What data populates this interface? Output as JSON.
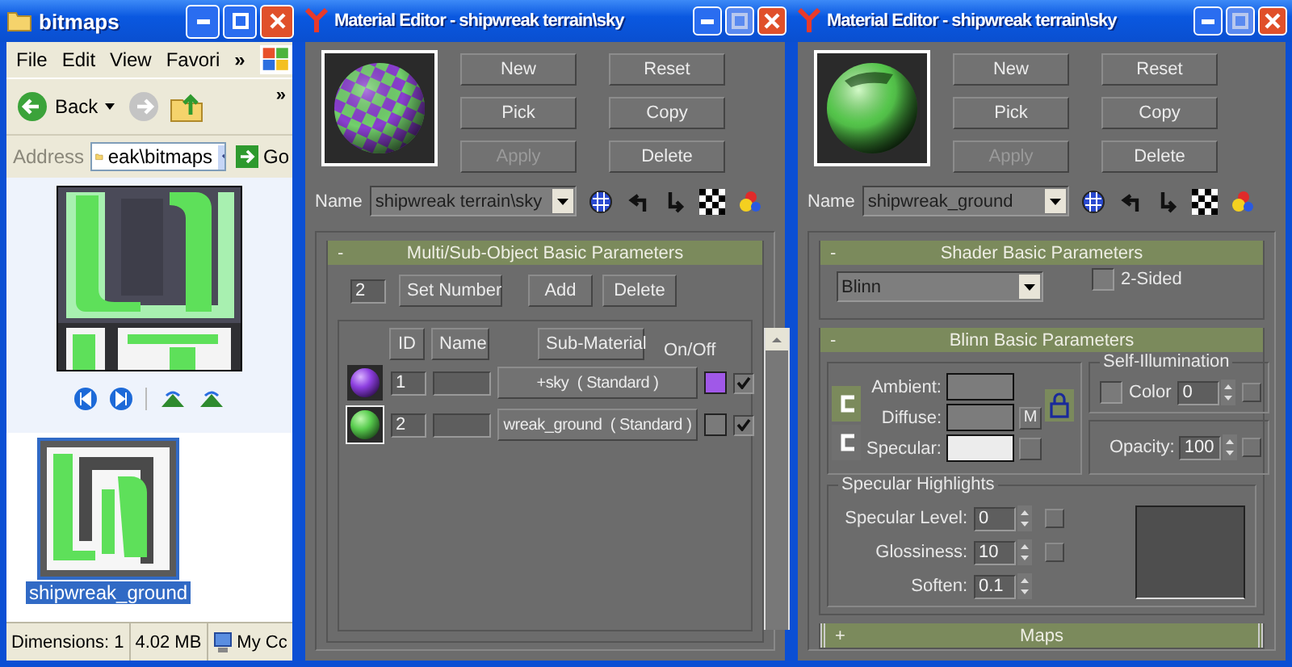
{
  "explorer": {
    "title": "bitmaps",
    "menu": [
      "File",
      "Edit",
      "View",
      "Favori"
    ],
    "menu_more": "»",
    "back": "Back",
    "toolbar_more": "»",
    "address": {
      "label": "Address",
      "value": "eak\\bitmaps",
      "go": "Go"
    },
    "file": {
      "name": "shipwreak_ground",
      "selected": true
    },
    "status": [
      "Dimensions: 1",
      "4.02 MB",
      "My Cc"
    ]
  },
  "editors": [
    {
      "title": "Material Editor - shipwreak terrain\\sky",
      "sample": {
        "kind": "checker"
      },
      "name_label": "Name",
      "name": "shipwreak terrain\\sky",
      "buttons": [
        {
          "label": "New",
          "disabled": false
        },
        {
          "label": "Reset",
          "disabled": false
        },
        {
          "label": "Pick",
          "disabled": false
        },
        {
          "label": "Copy",
          "disabled": false
        },
        {
          "label": "Apply",
          "disabled": true
        },
        {
          "label": "Delete",
          "disabled": false
        }
      ],
      "rollouts": [
        {
          "kind": "multi",
          "sign": "-",
          "title": "Multi/Sub-Object Basic Parameters",
          "expanded": true,
          "count": "2",
          "actions": [
            "Set Number",
            "Add",
            "Delete"
          ],
          "columns": [
            "ID",
            "Name",
            "Sub-Material",
            "On/Off"
          ],
          "rows": [
            {
              "sample": {
                "kind": "purple"
              },
              "selected": false,
              "id": "1",
              "material": "+sky  ( Standard )",
              "color": "#a058e8",
              "on": true
            },
            {
              "sample": {
                "kind": "green"
              },
              "selected": true,
              "id": "2",
              "material": "wreak_ground  ( Standard )",
              "color": "#7a7a7a",
              "on": true
            }
          ]
        }
      ]
    },
    {
      "title": "Material Editor - shipwreak terrain\\sky",
      "sample": {
        "kind": "green"
      },
      "name_label": "Name",
      "name": "shipwreak_ground",
      "buttons": [
        {
          "label": "New",
          "disabled": false
        },
        {
          "label": "Reset",
          "disabled": false
        },
        {
          "label": "Pick",
          "disabled": false
        },
        {
          "label": "Copy",
          "disabled": false
        },
        {
          "label": "Apply",
          "disabled": true
        },
        {
          "label": "Delete",
          "disabled": false
        }
      ],
      "rollouts": [
        {
          "kind": "shader",
          "sign": "-",
          "title": "Shader Basic Parameters",
          "expanded": true,
          "shader": "Blinn",
          "two_sided": {
            "label": "2-Sided",
            "checked": false
          }
        },
        {
          "kind": "blinn",
          "sign": "-",
          "title": "Blinn Basic Parameters",
          "expanded": true,
          "swatches": [
            {
              "label": "Ambient:",
              "color": "#7c7c7c"
            },
            {
              "label": "Diffuse:",
              "color": "#7c7c7c"
            },
            {
              "label": "Specular:",
              "color": "#ececec"
            }
          ],
          "map_letter": "M",
          "self_illum": {
            "title": "Self-Illumination",
            "label": "Color",
            "checked": false,
            "value": "0"
          },
          "opacity": {
            "label": "Opacity:",
            "value": "100"
          },
          "highlights": {
            "title": "Specular Highlights",
            "fields": [
              {
                "label": "Specular Level:",
                "value": "0"
              },
              {
                "label": "Glossiness:",
                "value": "10"
              },
              {
                "label": "Soften:",
                "value": "0.1"
              }
            ]
          }
        },
        {
          "kind": "collapsed",
          "sign": "+",
          "title": "Maps",
          "expanded": false
        }
      ]
    }
  ]
}
